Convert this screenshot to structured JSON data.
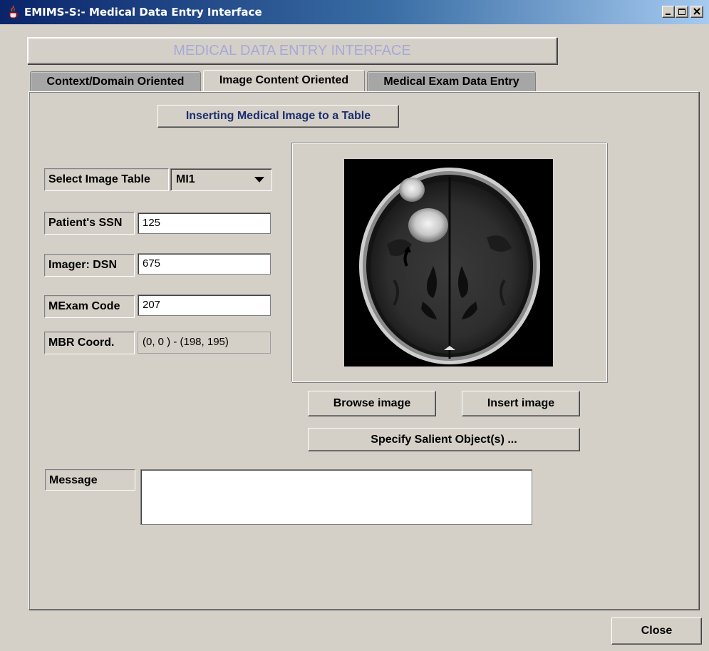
{
  "window": {
    "title": "EMIMS-S:- Medical Data Entry Interface",
    "icon": "java-cup-icon",
    "controls": [
      "minimize-icon",
      "maximize-icon",
      "close-icon"
    ]
  },
  "header": {
    "banner_label": "MEDICAL DATA ENTRY INTERFACE"
  },
  "tabs": [
    {
      "label": "Context/Domain Oriented",
      "active": false
    },
    {
      "label": "Image Content Oriented",
      "active": true
    },
    {
      "label": "Medical Exam Data Entry",
      "active": false
    }
  ],
  "panel": {
    "insert_table_button": "Inserting Medical Image to a Table",
    "form": {
      "image_table": {
        "label": "Select Image Table",
        "selected": "MI1"
      },
      "patient_ssn": {
        "label": "Patient's SSN",
        "value": "125"
      },
      "imager_dsn": {
        "label": "Imager: DSN",
        "value": "675"
      },
      "mexam_code": {
        "label": "MExam Code",
        "value": "207"
      },
      "mbr_coord": {
        "label": "MBR Coord.",
        "value": "(0, 0 ) - (198, 195)"
      }
    },
    "image": {
      "kind": "axial brain MRI scan"
    },
    "buttons": {
      "browse": "Browse image",
      "insert": "Insert image",
      "salient": "Specify Salient Object(s) ..."
    },
    "message": {
      "label": "Message",
      "value": ""
    }
  },
  "footer": {
    "close_label": "Close"
  },
  "colors": {
    "title_bar": "#0a246a",
    "background": "#d4d0c8",
    "banner_text": "#a8a8d8",
    "accent_button_text": "#1c2d6e"
  }
}
